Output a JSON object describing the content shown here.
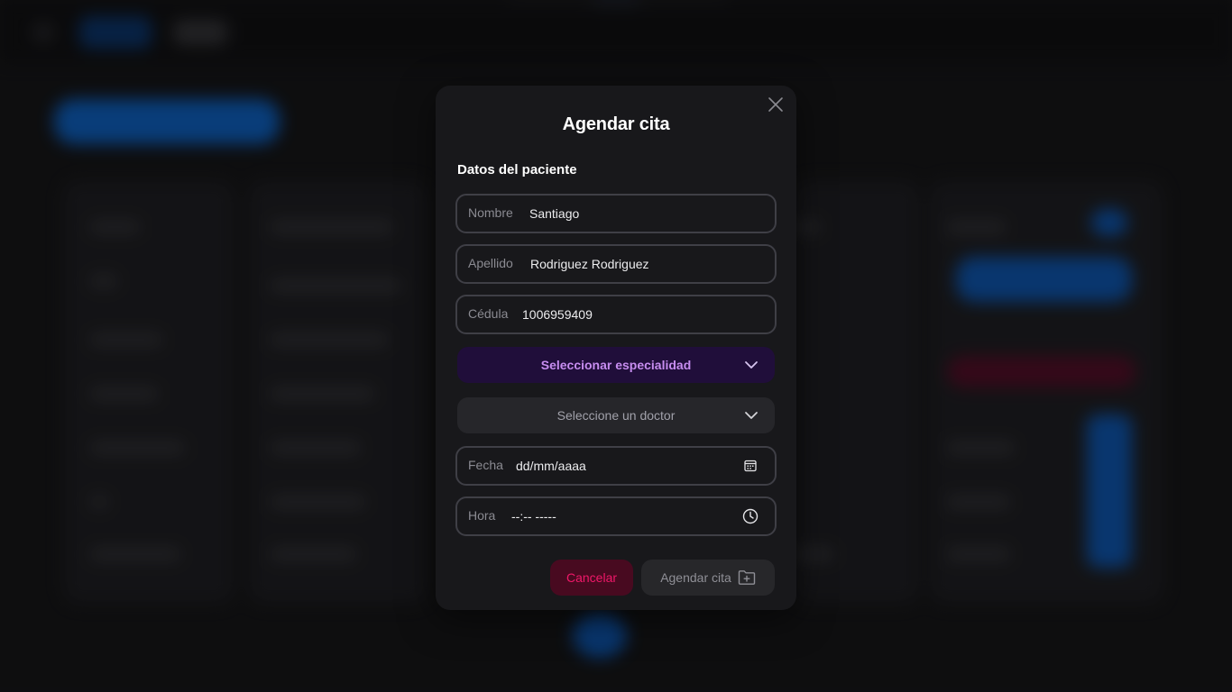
{
  "modal": {
    "title": "Agendar cita",
    "section_title": "Datos del paciente",
    "fields": {
      "nombre": {
        "label": "Nombre",
        "value": "Santiago"
      },
      "apellido": {
        "label": "Apellido",
        "value": "Rodriguez Rodriguez"
      },
      "cedula": {
        "label": "Cédula",
        "value": "1006959409"
      },
      "fecha": {
        "label": "Fecha",
        "placeholder": "dd/mm/aaaa",
        "icon": "calendar-icon"
      },
      "hora": {
        "label": "Hora",
        "placeholder": "--:-- -----",
        "icon": "clock-icon"
      }
    },
    "selects": {
      "especialidad": {
        "text": "Seleccionar especialidad",
        "icon": "chevron-down-icon"
      },
      "doctor": {
        "text": "Seleccione un doctor",
        "icon": "chevron-down-icon"
      }
    },
    "buttons": {
      "cancel": "Cancelar",
      "submit": "Agendar cita",
      "submit_icon": "folder-plus-icon",
      "close_icon": "close-icon"
    }
  },
  "colors": {
    "accent_purple": "#c78df0",
    "danger": "#f01869",
    "modal_bg": "#18181b",
    "border": "#3f3f46"
  }
}
